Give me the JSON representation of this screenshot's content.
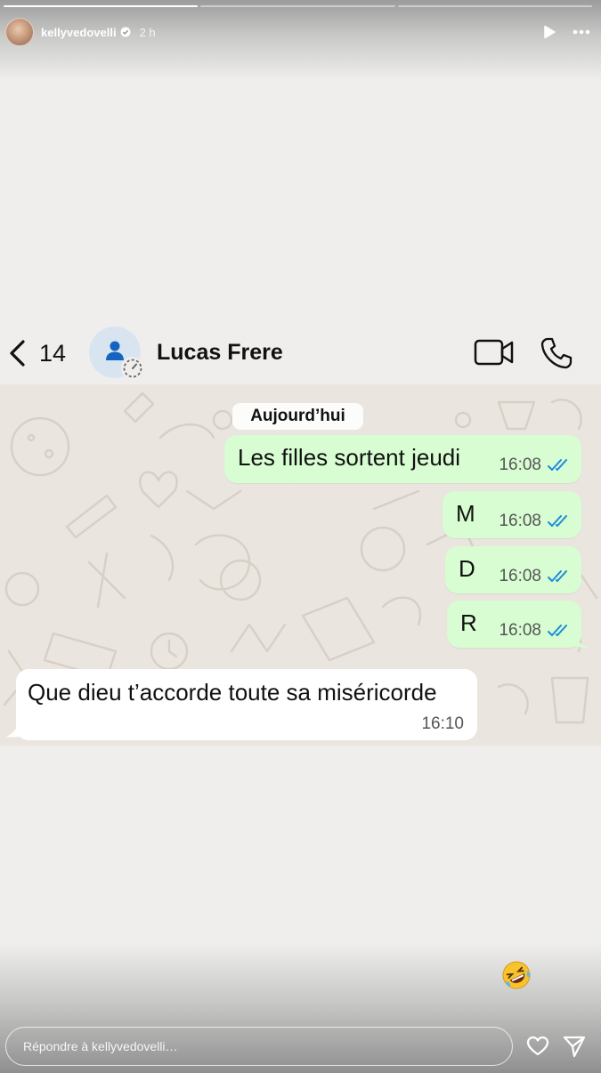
{
  "story": {
    "username": "kellyvedovelli",
    "time_ago": "2 h",
    "progress": [
      1.0,
      0.0,
      0.0
    ],
    "reply_placeholder": "Répondre à kellyvedovelli…",
    "icons": [
      "play-icon",
      "more-icon",
      "verified-icon",
      "heart-icon",
      "send-icon",
      "laughing-emoji"
    ]
  },
  "whatsapp": {
    "back_count": "14",
    "contact_name": "Lucas Frere",
    "date_label": "Aujourd’hui",
    "messages": [
      {
        "direction": "out",
        "text": "Les filles sortent jeudi",
        "time": "16:08",
        "status": "read"
      },
      {
        "direction": "out",
        "text": "M",
        "time": "16:08",
        "status": "read"
      },
      {
        "direction": "out",
        "text": "D",
        "time": "16:08",
        "status": "read"
      },
      {
        "direction": "out",
        "text": "R",
        "time": "16:08",
        "status": "read"
      },
      {
        "direction": "in",
        "text": "Que dieu t’accorde toute sa miséricorde",
        "time": "16:10"
      }
    ],
    "colors": {
      "outgoing_bubble": "#d8fdd2",
      "incoming_bubble": "#ffffff",
      "read_ticks": "#1a8cd8",
      "chat_background": "#eae5de"
    }
  }
}
